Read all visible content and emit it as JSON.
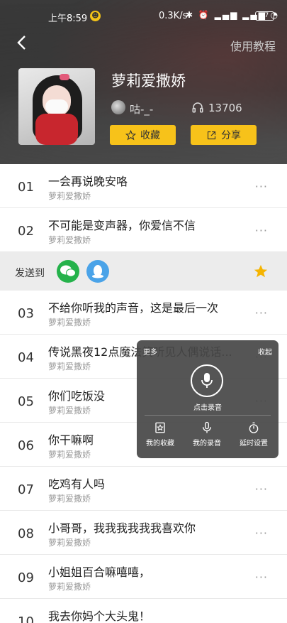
{
  "status_bar": {
    "time": "上午8:59",
    "notification_badge": "☻",
    "net_speed": "0.3K/s",
    "battery": "47"
  },
  "header": {
    "help_label": "使用教程",
    "album_title": "萝莉爱撒娇",
    "author": "咕-_-",
    "listen_count": "13706",
    "favorite_label": "收藏",
    "share_label": "分享",
    "accent_color": "#f7c21a"
  },
  "send_to": {
    "label": "发送到",
    "targets": [
      "wechat-icon",
      "qq-icon"
    ]
  },
  "tracks": [
    {
      "num": "01",
      "name": "一会再说晚安咯",
      "artist": "萝莉爱撒娇"
    },
    {
      "num": "02",
      "name": "不可能是变声器，你爱信不信",
      "artist": "萝莉爱撒娇"
    },
    {
      "num": "03",
      "name": "不给你听我的声音，这是最后一次",
      "artist": "萝莉爱撒娇"
    },
    {
      "num": "04",
      "name": "传说黑夜12点魔法笑听见人偶说话...",
      "artist": "萝莉爱撒娇"
    },
    {
      "num": "05",
      "name": "你们吃饭没",
      "artist": "萝莉爱撒娇"
    },
    {
      "num": "06",
      "name": "你干嘛啊",
      "artist": "萝莉爱撒娇"
    },
    {
      "num": "07",
      "name": "吃鸡有人吗",
      "artist": "萝莉爱撒娇"
    },
    {
      "num": "08",
      "name": "小哥哥，我我我我我我喜欢你",
      "artist": "萝莉爱撒娇"
    },
    {
      "num": "09",
      "name": "小姐姐百合嘛嘻嘻，",
      "artist": "萝莉爱撒娇"
    },
    {
      "num": "10",
      "name": "我去你妈个大头鬼！",
      "artist": ""
    }
  ],
  "more_glyph": "···",
  "panel": {
    "more_label": "更多",
    "collapse_label": "收起",
    "record_label": "点击录音",
    "actions": [
      "我的收藏",
      "我的录音",
      "延时设置"
    ]
  }
}
